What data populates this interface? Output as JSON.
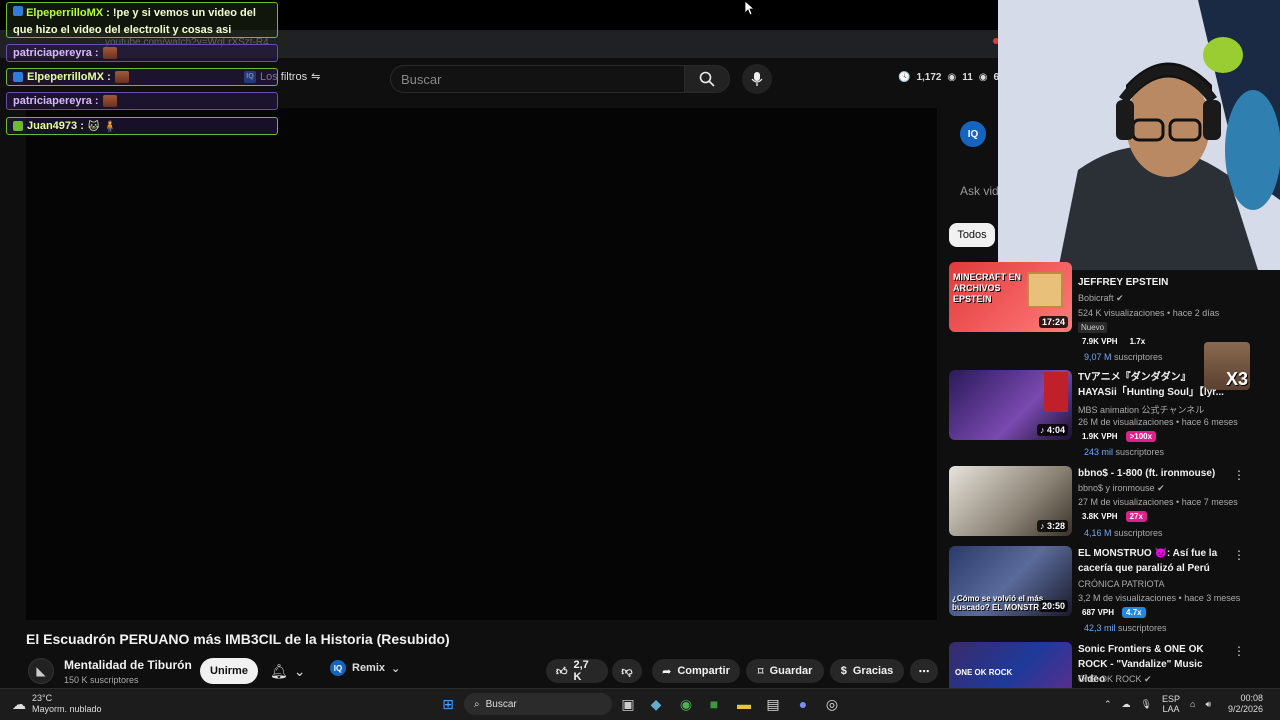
{
  "browser": {
    "url": "youtube.com/watch?v=WqLrXSzt-R4"
  },
  "header": {
    "search_placeholder": "Buscar",
    "filters_label": "Los filtros",
    "stats": {
      "clock": "1,172",
      "eye1": "11",
      "eye2": "658"
    }
  },
  "chat": {
    "first": {
      "user": "ElpeperrilloMX",
      "text": ": !pe y si vemos un video del que hizo el video del electrolit y cosas asi"
    },
    "lines": [
      {
        "user": "patriciapereyra :",
        "style": "purple"
      },
      {
        "user": "ElpeperrilloMX :",
        "style": "green"
      },
      {
        "user": "patriciapereyra :",
        "style": "purple"
      },
      {
        "user": "Juan4973 :",
        "style": "green"
      }
    ]
  },
  "video": {
    "title": "El Escuadrón PERUANO más IMB3CIL de la Historia (Resubido)",
    "channel": "Mentalidad de Tiburón",
    "subscribers": "150 K suscriptores",
    "join_label": "Unirme",
    "remix_label": "Remix",
    "likes": "2,7 K",
    "share_label": "Compartir",
    "save_label": "Guardar",
    "thanks_label": "Gracias"
  },
  "sidebar": {
    "ask_placeholder": "Ask vid",
    "chip_all": "Todos",
    "recs": [
      {
        "title": "JEFFREY EPSTEIN",
        "channel": "Bobicraft",
        "meta": "524 K visualizaciones • hace 2 días",
        "badge": "Nuevo",
        "duration": "17:24",
        "vph": "7.9K VPH",
        "mult": "1.7x",
        "mult_color": "none",
        "subs_count": "9,07 M",
        "subs_label": "suscriptores",
        "thumb_text": "MINECRAFT EN ARCHIVOS EPSTEIN"
      },
      {
        "title": "TVアニメ『ダンダダン』HAYASii「Hunting Soul」【lyr...",
        "channel": "MBS animation 公式チャンネル",
        "meta": "26 M de visualizaciones • hace 6 meses",
        "duration": "4:04",
        "vph": "1.9K VPH",
        "mult": ">100x",
        "mult_color": "pink",
        "subs_count": "243 mil",
        "subs_label": "suscriptores"
      },
      {
        "title": "bbno$ - 1-800 (ft. ironmouse)",
        "channel": "bbno$ y ironmouse",
        "meta": "27 M de visualizaciones • hace 7 meses",
        "duration": "3:28",
        "vph": "3.8K VPH",
        "mult": "27x",
        "mult_color": "pink",
        "subs_count": "4,16 M",
        "subs_label": "suscriptores"
      },
      {
        "title": "EL MONSTRUO 👿: Así fue la cacería que paralizó al Perú",
        "channel": "CRÓNICA PATRIOTA",
        "meta": "3,2 M de visualizaciones • hace 3 meses",
        "duration": "20:50",
        "vph": "687 VPH",
        "mult": "4.7x",
        "mult_color": "blue",
        "subs_count": "42,3 mil",
        "subs_label": "suscriptores",
        "thumb_text": "¿Cómo se volvió el más buscado? EL MONSTRUO"
      },
      {
        "title": "Sonic Frontiers & ONE OK ROCK - \"Vandalize\" Music Video",
        "channel": "ONE OK ROCK",
        "thumb_text": "ONE OK ROCK"
      }
    ],
    "x3_overlay": "X3"
  },
  "taskbar": {
    "weather_temp": "23°C",
    "weather_desc": "Mayorm. nublado",
    "search_label": "Buscar",
    "lang1": "ESP",
    "lang2": "LAA",
    "time": "00:08",
    "date": "9/2/2026"
  }
}
